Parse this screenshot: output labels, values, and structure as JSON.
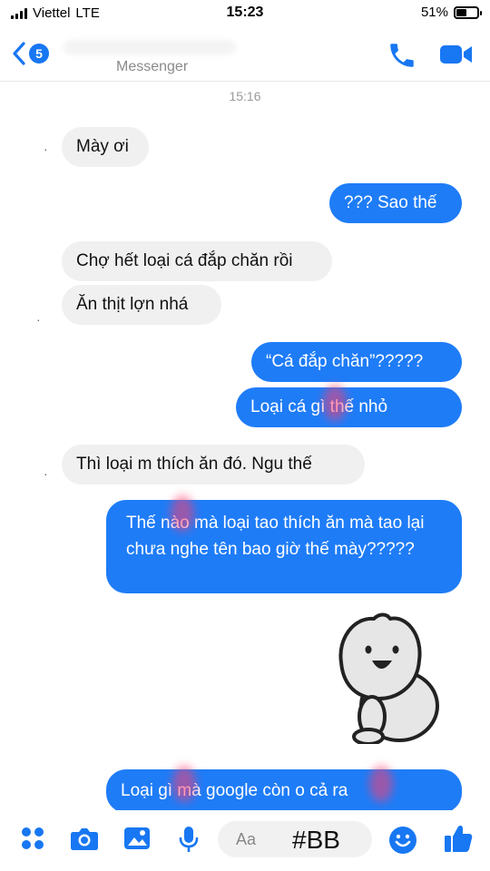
{
  "status_bar": {
    "carrier": "Viettel",
    "network": "LTE",
    "time": "15:23",
    "battery": "51%",
    "battery_level": 0.51
  },
  "header": {
    "back_count": "5",
    "subtitle": "Messenger"
  },
  "chat": {
    "timestamp": "15:16",
    "messages": [
      {
        "side": "in",
        "text": "Mày ơi"
      },
      {
        "side": "out",
        "text": "??? Sao thế"
      },
      {
        "side": "in",
        "text": "Chợ hết loại cá đắp chăn rồi"
      },
      {
        "side": "in",
        "text": "Ăn thịt lợn nhá"
      },
      {
        "side": "out",
        "text": "“Cá đắp chăn”?????"
      },
      {
        "side": "out",
        "text": "Loại cá gì thế nhỏ"
      },
      {
        "side": "in",
        "text": "Thì loại m thích ăn đó. Ngu thế"
      },
      {
        "side": "out",
        "text": "Thế nào mà loại tao thích ăn mà tao lại chưa nghe tên bao giờ thế mày?????"
      },
      {
        "side": "out",
        "text": "Loại gì mà google còn o cả ra"
      }
    ]
  },
  "composer": {
    "placeholder": "Aa",
    "overlay_text": "#BB"
  },
  "colors": {
    "accent": "#1877f2",
    "outgoing_bubble": "#1e7cf7",
    "incoming_bubble": "#f0f0f0"
  }
}
